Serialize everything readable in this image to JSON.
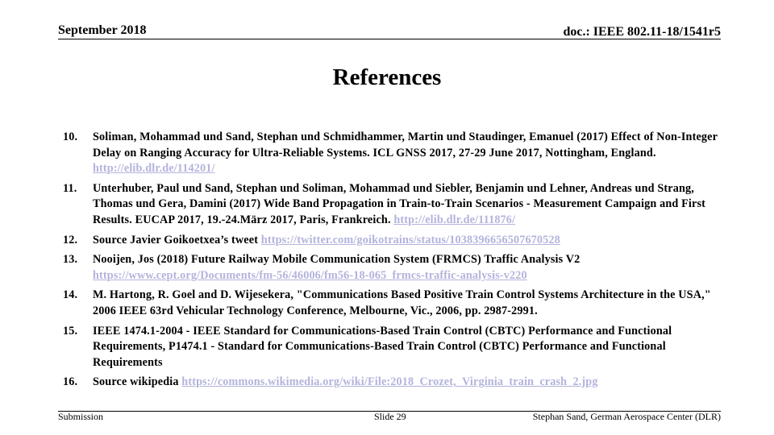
{
  "header": {
    "date": "September 2018",
    "doc_id": "doc.: IEEE 802.11-18/1541r5"
  },
  "title": "References",
  "references": [
    {
      "num": "10.",
      "text": "Soliman, Mohammad und Sand, Stephan und Schmidhammer, Martin und Staudinger, Emanuel (2017) Effect of Non-Integer Delay on Ranging Accuracy for Ultra-Reliable Systems. ICL GNSS 2017, 27-29 June 2017, Nottingham, England. ",
      "link": "http://elib.dlr.de/114201/"
    },
    {
      "num": "11.",
      "text": "Unterhuber, Paul und Sand, Stephan und Soliman, Mohammad und Siebler, Benjamin und Lehner, Andreas und Strang, Thomas und Gera, Damini (2017) Wide Band Propagation in Train-to-Train Scenarios - Measurement Campaign and First Results. EUCAP 2017, 19.-24.März 2017, Paris, Frankreich. ",
      "link": "http://elib.dlr.de/111876/"
    },
    {
      "num": "12.",
      "text": "Source  Javier Goikoetxea’s tweet ",
      "link": "https://twitter.com/goikotrains/status/1038396656507670528"
    },
    {
      "num": "13.",
      "text": "Nooijen, Jos (2018) Future Railway Mobile Communication System (FRMCS) Traffic Analysis V2 ",
      "link": "https://www.cept.org/Documents/fm-56/46006/fm56-18-065_frmcs-traffic-analysis-v220"
    },
    {
      "num": "14.",
      "text": "M. Hartong, R. Goel and D. Wijesekera, \"Communications Based Positive Train Control Systems Architecture in the USA,\" 2006 IEEE 63rd Vehicular Technology Conference, Melbourne, Vic., 2006, pp. 2987-2991.",
      "link": ""
    },
    {
      "num": "15.",
      "text": "IEEE 1474.1-2004 - IEEE Standard for Communications-Based Train Control (CBTC) Performance and Functional Requirements, P1474.1 - Standard for Communications-Based Train Control (CBTC) Performance and Functional Requirements",
      "link": ""
    },
    {
      "num": "16.",
      "text": "Source wikipedia ",
      "link": "https://commons.wikimedia.org/wiki/File:2018_Crozet,_Virginia_train_crash_2.jpg"
    }
  ],
  "footer": {
    "left": "Submission",
    "center": "Slide 29",
    "right": "Stephan Sand, German Aerospace Center (DLR)"
  },
  "colors": {
    "link": "#b3b3dd",
    "text": "#000000"
  }
}
